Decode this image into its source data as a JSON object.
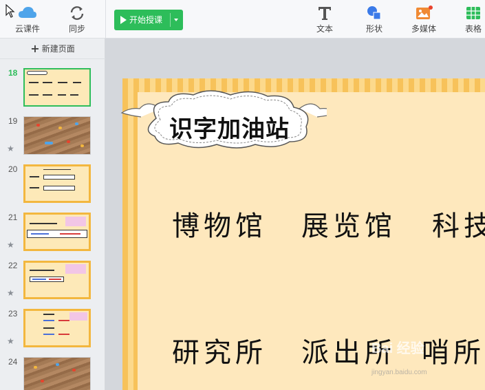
{
  "toolbar": {
    "cloud_label": "云课件",
    "sync_label": "同步",
    "start_label": "开始授课",
    "text_label": "文本",
    "shape_label": "形状",
    "media_label": "多媒体",
    "table_label": "表格",
    "accent": "#2dbd5a"
  },
  "sidebar": {
    "new_page_label": "新建页面",
    "thumbs": [
      {
        "num": "18",
        "active": true
      },
      {
        "num": "19",
        "star": true
      },
      {
        "num": "20"
      },
      {
        "num": "21",
        "star": true
      },
      {
        "num": "22",
        "star": true
      },
      {
        "num": "23",
        "star": true
      },
      {
        "num": "24"
      }
    ]
  },
  "slide": {
    "title": "识字加油站",
    "row1": [
      "博物馆",
      "展览馆",
      "科技"
    ],
    "row2": [
      "研究所",
      "派出所",
      "哨所"
    ]
  },
  "watermark": {
    "brand": "Bai 经验",
    "url": "jingyan.baidu.com"
  }
}
